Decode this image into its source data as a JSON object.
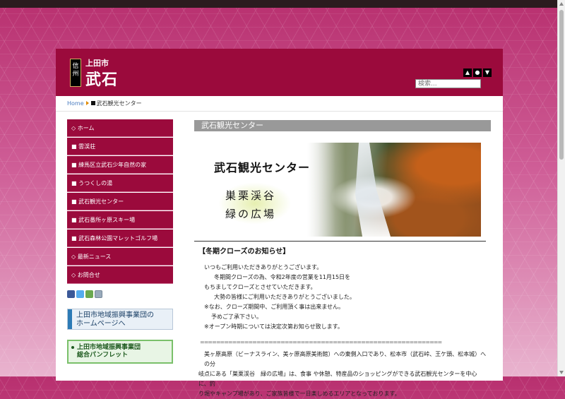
{
  "header": {
    "logo_vertical": "信州",
    "logo_small": "上田市",
    "logo_big": "武石",
    "search_placeholder": "検索..."
  },
  "nav_icons": [
    "▲",
    "●",
    "▼"
  ],
  "breadcrumb": {
    "home": "Home",
    "current": "武石観光センター"
  },
  "sidebar": {
    "items": [
      {
        "label": "◇ ホーム"
      },
      {
        "label": "■ 雲渓荘"
      },
      {
        "label": "■ 練馬区立武石少年自然の家"
      },
      {
        "label": "■ うつくしの湯"
      },
      {
        "label": "■ 武石観光センター"
      },
      {
        "label": "■ 武石番所ヶ原スキー場"
      },
      {
        "label": "■ 武石森林公園マレットゴルフ場"
      },
      {
        "label": "◇ 最新ニュース"
      },
      {
        "label": "◇ お問合せ"
      }
    ],
    "share_icons": [
      "facebook-icon",
      "twitter-icon",
      "hatena-icon",
      "mail-icon"
    ],
    "banner1_line1": "上田市地域振興事業団の",
    "banner1_line2": "ホームページへ",
    "banner2_line1": "上田市地域振興事業団",
    "banner2_line2": "総合パンフレット"
  },
  "main": {
    "page_title": "武石観光センター",
    "hero_title": "武石観光センター",
    "hero_sub1": "巣栗渓谷",
    "hero_sub2": "緑の広場",
    "notice_title": "【冬期クローズのお知らせ】",
    "notice_lines": [
      "いつもご利用いただきありがとうございます。",
      "冬期間クローズの為、令和2年度の営業を11月15日を",
      "もちましてクローズとさせていただきます。",
      "大勢の皆様にご利用いただきありがとうございました。",
      "※なお、クローズ期間中、ご利用頂く事は出来ません。",
      "予めご了承下さい。",
      "※オープン時期については決定次第お知らせ致します。"
    ],
    "divider": "============================================================",
    "para_line1": "美ヶ原高原（ビーナスライン、美ヶ原高原美術館）への東側入口であり、松本市（武石峠、王ケ頭、松本城）への分",
    "para_line2": "岐点にある「巣栗渓谷　緑の広場」は、食事 や休憩、特産品のショッピングができる武石観光センターを中心に、釣",
    "para_line3": "り堀やキャンプ場があり、ご家族皆様で一日楽しめるエリアとなっております。"
  },
  "colors": {
    "brand": "#9b0a3c",
    "page_title_bg": "#999999",
    "breadcrumb_link": "#4a7cc0"
  }
}
